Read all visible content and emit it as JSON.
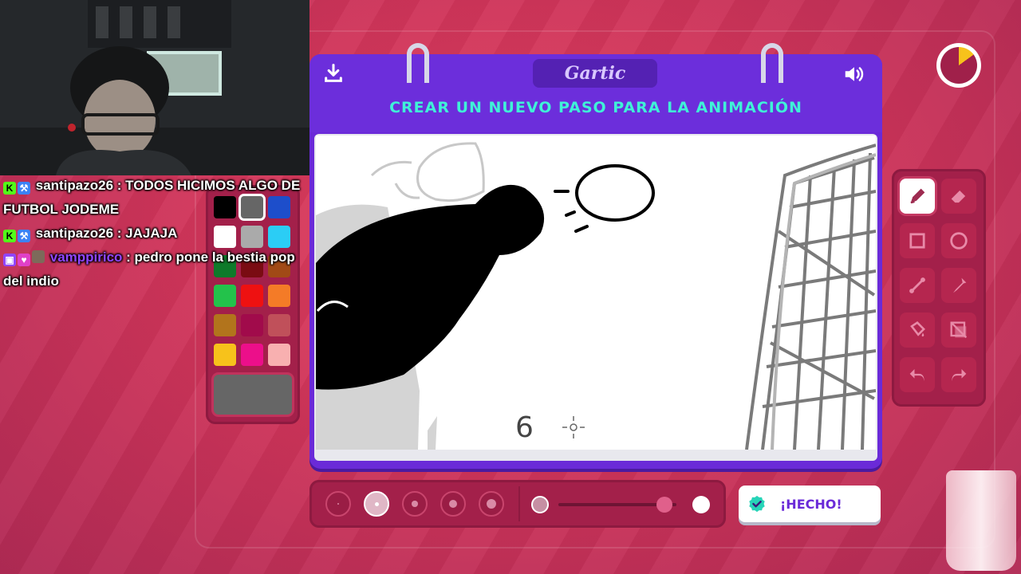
{
  "game": {
    "logo": "Gartic",
    "title": "CREAR UN NUEVO PASO PARA LA ANIMACIÓN",
    "done_label": "¡HECHO!",
    "canvas_number": "6"
  },
  "chat": {
    "messages": [
      {
        "user": "santipazo26",
        "sep": " : ",
        "text": "TODOS HICIMOS ALGO DE FUTBOL JODEME",
        "badges": [
          "kick-badge",
          "pickaxe-badge"
        ]
      },
      {
        "user": "santipazo26",
        "sep": " : ",
        "text": "JAJAJA",
        "badges": [
          "kick-badge",
          "pickaxe-badge"
        ]
      },
      {
        "user": "vamppirico",
        "sep": " : ",
        "text": "pedro pone la bestia pop del indio",
        "badges": [
          "twitch-badge",
          "heart-badge",
          "avatar-badge"
        ]
      }
    ]
  },
  "palette": {
    "colors": [
      "#000000",
      "#666666",
      "#1d4ecb",
      "#ffffff",
      "#aaaaaa",
      "#2bcdf5",
      "#0e7a2a",
      "#7a0c12",
      "#a14a16",
      "#23c24b",
      "#ee1111",
      "#f47b27",
      "#b2741c",
      "#a10b4b",
      "#c0505a",
      "#f7c21b",
      "#ec0f8a",
      "#f8b0b0"
    ],
    "selected_index": 1,
    "current_color": "#666666"
  },
  "tools": [
    "pencil-tool",
    "eraser-tool",
    "rectangle-tool",
    "circle-tool",
    "line-tool",
    "eyedropper-tool",
    "fill-tool",
    "layer-tool",
    "undo-tool",
    "redo-tool"
  ],
  "active_tool": "pencil-tool",
  "brush": {
    "selected_size_index": 1,
    "opacity": 0.9
  },
  "timer": {
    "remaining_fraction": 0.15
  }
}
